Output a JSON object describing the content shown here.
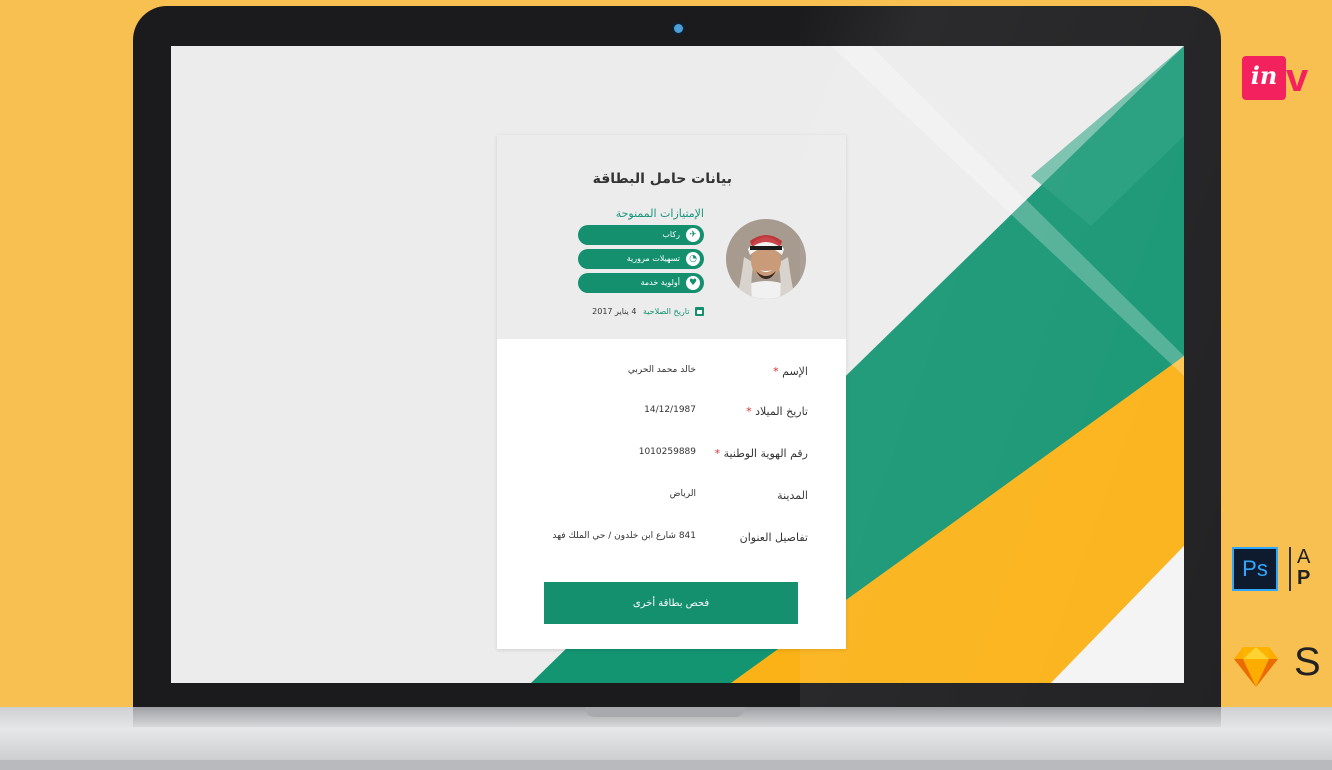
{
  "card": {
    "title": "بيانات حامل البطاقة",
    "privileges_title": "الإمتيازات الممنوحة",
    "privileges": [
      {
        "label": "ركاب",
        "icon": "plane-icon"
      },
      {
        "label": "تسهيلات مرورية",
        "icon": "clock-icon"
      },
      {
        "label": "أولوية خدمة",
        "icon": "heart-icon"
      }
    ],
    "expiry_label": "تاريخ الصلاحية",
    "expiry_value": "4 يناير 2017",
    "fields": [
      {
        "label": "الإسم",
        "required": true,
        "value": "خالد محمد الحربي"
      },
      {
        "label": "تاريخ الميلاد",
        "required": true,
        "value": "14/12/1987"
      },
      {
        "label": "رقم الهوية الوطنية",
        "required": true,
        "value": "1010259889"
      },
      {
        "label": "المدينة",
        "required": false,
        "value": "الرياض"
      },
      {
        "label": "تفاصيل العنوان",
        "required": false,
        "value": "841 شارع ابن خلدون / حي الملك فهد"
      }
    ],
    "required_mark": "*",
    "button_label": "فحص بطاقة أخرى"
  },
  "logos": {
    "invision_mark": "in",
    "invision_letter": "v",
    "ps_mark": "Ps",
    "ps_text_a": "A",
    "ps_text_p": "P",
    "sketch_letter": "S"
  },
  "colors": {
    "background": "#f7c051",
    "brand_green": "#14906f",
    "required_red": "#e02e2e",
    "invision_pink": "#f3225f",
    "ps_blue": "#31a8ff",
    "accent_yellow": "#fbb217"
  }
}
